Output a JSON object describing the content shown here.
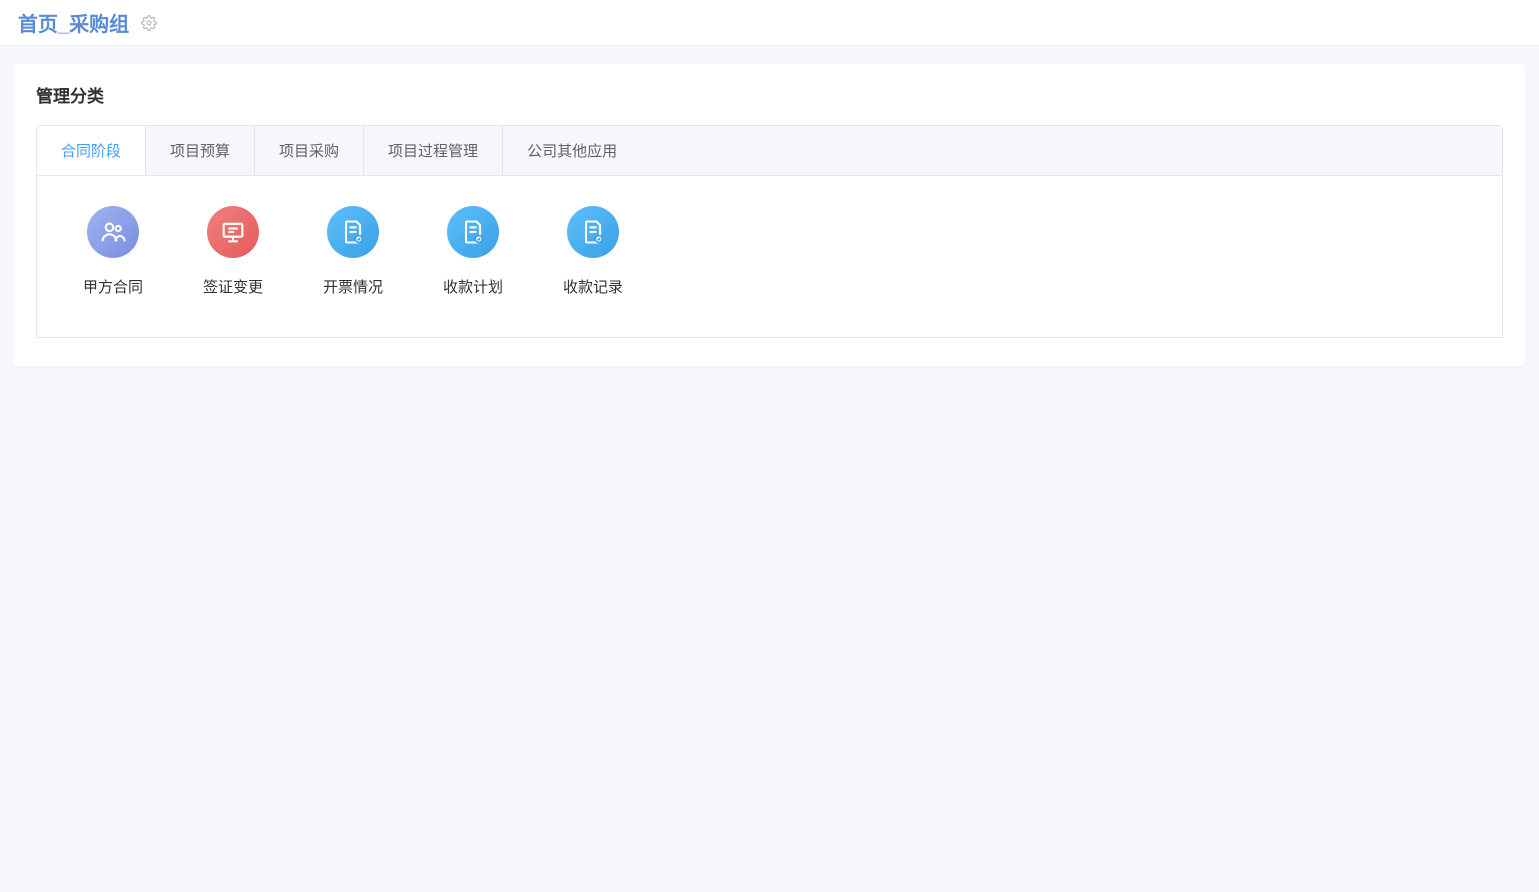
{
  "header": {
    "title": "首页_采购组"
  },
  "panel": {
    "title": "管理分类",
    "tabs": [
      {
        "label": "合同阶段",
        "active": true
      },
      {
        "label": "项目预算",
        "active": false
      },
      {
        "label": "项目采购",
        "active": false
      },
      {
        "label": "项目过程管理",
        "active": false
      },
      {
        "label": "公司其他应用",
        "active": false
      }
    ],
    "apps": [
      {
        "label": "甲方合同",
        "icon": "people",
        "color": "purple"
      },
      {
        "label": "签证变更",
        "icon": "board",
        "color": "red"
      },
      {
        "label": "开票情况",
        "icon": "doc-badge",
        "color": "blue"
      },
      {
        "label": "收款计划",
        "icon": "doc-badge",
        "color": "blue"
      },
      {
        "label": "收款记录",
        "icon": "doc-badge",
        "color": "blue"
      }
    ]
  }
}
